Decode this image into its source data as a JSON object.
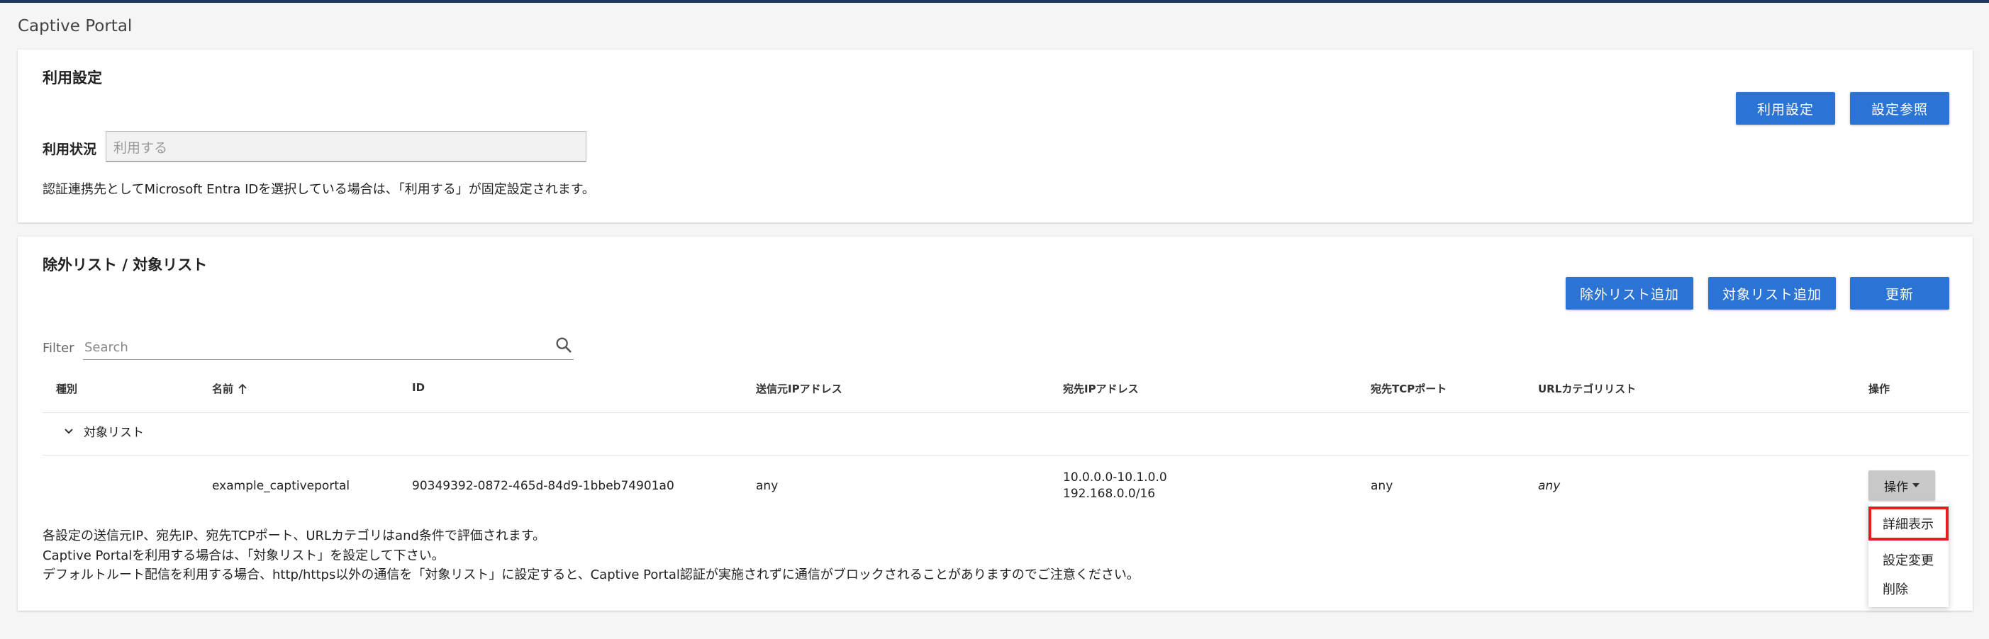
{
  "app": {
    "title": "Captive Portal"
  },
  "usage_section": {
    "title": "利用設定",
    "buttons": {
      "usage_setting": "利用設定",
      "view_settings": "設定参照"
    },
    "status_label": "利用状況",
    "status_value": "利用する",
    "note": "認証連携先としてMicrosoft Entra IDを選択している場合は、「利用する」が固定設定されます。"
  },
  "list_section": {
    "title": "除外リスト / 対象リスト",
    "buttons": {
      "add_exclusion": "除外リスト追加",
      "add_target": "対象リスト追加",
      "refresh": "更新"
    },
    "filter_label": "Filter",
    "search_placeholder": "Search",
    "columns": {
      "type": "種別",
      "name": "名前",
      "id": "ID",
      "src_ip": "送信元IPアドレス",
      "dst_ip": "宛先IPアドレス",
      "dst_tcp_port": "宛先TCPポート",
      "url_category_list": "URLカテゴリリスト",
      "actions": "操作"
    },
    "group": {
      "label": "対象リスト"
    },
    "rows": [
      {
        "type": "",
        "name": "example_captiveportal",
        "id": "90349392-0872-465d-84d9-1bbeb74901a0",
        "src_ip": "any",
        "dst_ip": [
          "10.0.0.0-10.1.0.0",
          "192.168.0.0/16"
        ],
        "dst_tcp_port": "any",
        "url_category_list": "any",
        "action_label": "操作"
      }
    ],
    "action_menu": [
      "詳細表示",
      "設定変更",
      "削除"
    ],
    "notes": [
      "各設定の送信元IP、宛先IP、宛先TCPポート、URLカテゴリはand条件で評価されます。",
      "Captive Portalを利用する場合は、「対象リスト」を設定して下さい。",
      "デフォルトルート配信を利用する場合、http/https以外の通信を「対象リスト」に設定すると、Captive Portal認証が実施されずに通信がブロックされることがありますのでご注意ください。"
    ]
  },
  "colors": {
    "primary": "#2b74d6",
    "highlight": "#e51c23",
    "topbar": "#1f3a60"
  }
}
